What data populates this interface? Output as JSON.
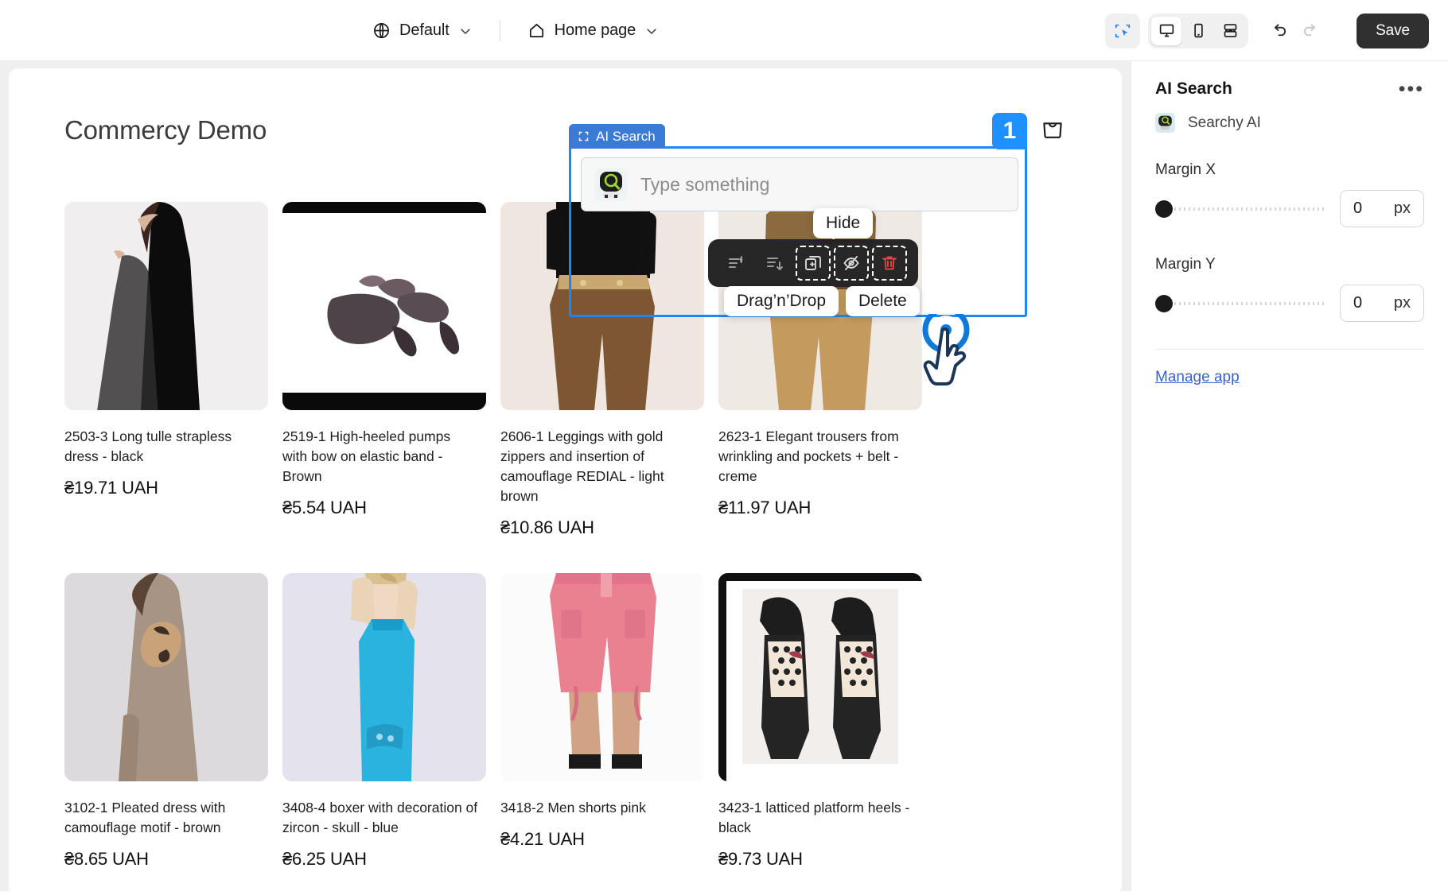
{
  "topbar": {
    "globe_icon": "globe-icon",
    "theme_label": "Default",
    "home_icon": "home-icon",
    "page_label": "Home page",
    "chevron_icon": "chevron-down-icon",
    "select_tool_icon": "select-area-icon",
    "desktop_icon": "desktop-icon",
    "mobile_icon": "mobile-icon",
    "responsive_icon": "responsive-icon",
    "undo_icon": "undo-icon",
    "redo_icon": "redo-icon",
    "save_label": "Save"
  },
  "site": {
    "title": "Commercy Demo",
    "cart_icon": "shopping-bag-icon"
  },
  "widget": {
    "badge_icon": "frame-select-icon",
    "badge_label": "AI Search",
    "order_number": "1",
    "bot_icon": "searchy-bot-icon",
    "search_placeholder": "Type something",
    "search_value": "",
    "toolbar": {
      "move_up_icon": "move-up-icon",
      "move_down_icon": "move-down-icon",
      "duplicate_icon": "duplicate-icon",
      "hide_icon": "eye-off-icon",
      "delete_icon": "trash-icon",
      "tooltip_hide": "Hide",
      "tooltip_drag": "Drag’n’Drop",
      "tooltip_delete": "Delete"
    },
    "cursor_icon": "tap-pointer-icon"
  },
  "products": [
    {
      "title": "2503-3 Long tulle strapless dress - black",
      "price": "₴19.71 UAH",
      "image_name": "product-image-long-tulle-dress"
    },
    {
      "title": "2519-1 High-heeled pumps with bow on elastic band - Brown",
      "price": "₴5.54 UAH",
      "image_name": "product-image-high-heeled-pumps"
    },
    {
      "title": "2606-1 Leggings with gold zippers and insertion of camouflage REDIAL - light brown",
      "price": "₴10.86 UAH",
      "image_name": "product-image-leggings-camouflage"
    },
    {
      "title": "2623-1 Elegant trousers from wrinkling and pockets + belt - creme",
      "price": "₴11.97 UAH",
      "image_name": "product-image-elegant-trousers"
    },
    {
      "title": "3102-1 Pleated dress with camouflage motif - brown",
      "price": "₴8.65 UAH",
      "image_name": "product-image-pleated-dress"
    },
    {
      "title": "3408-4 boxer with decoration of zircon - skull - blue",
      "price": "₴6.25 UAH",
      "image_name": "product-image-boxer-zircon-skull"
    },
    {
      "title": "3418-2 Men shorts pink",
      "price": "₴4.21 UAH",
      "image_name": "product-image-men-shorts-pink"
    },
    {
      "title": "3423-1 latticed platform heels - black",
      "price": "₴9.73 UAH",
      "image_name": "product-image-latticed-platform-heels"
    }
  ],
  "panel": {
    "title": "AI Search",
    "menu_icon": "more-horizontal-icon",
    "app_icon": "searchy-ai-app-icon",
    "app_name": "Searchy AI",
    "fields": [
      {
        "label": "Margin X",
        "value": "0",
        "unit": "px",
        "slider_position": 0
      },
      {
        "label": "Margin Y",
        "value": "0",
        "unit": "px",
        "slider_position": 0
      }
    ],
    "manage_link": "Manage app"
  },
  "colors": {
    "accent_blue": "#1e90ff",
    "tag_blue": "#3a7bd5",
    "toolbar_dark": "#272727",
    "delete_red": "#e04646",
    "link_blue": "#3b61c9",
    "save_dark": "#303030"
  }
}
